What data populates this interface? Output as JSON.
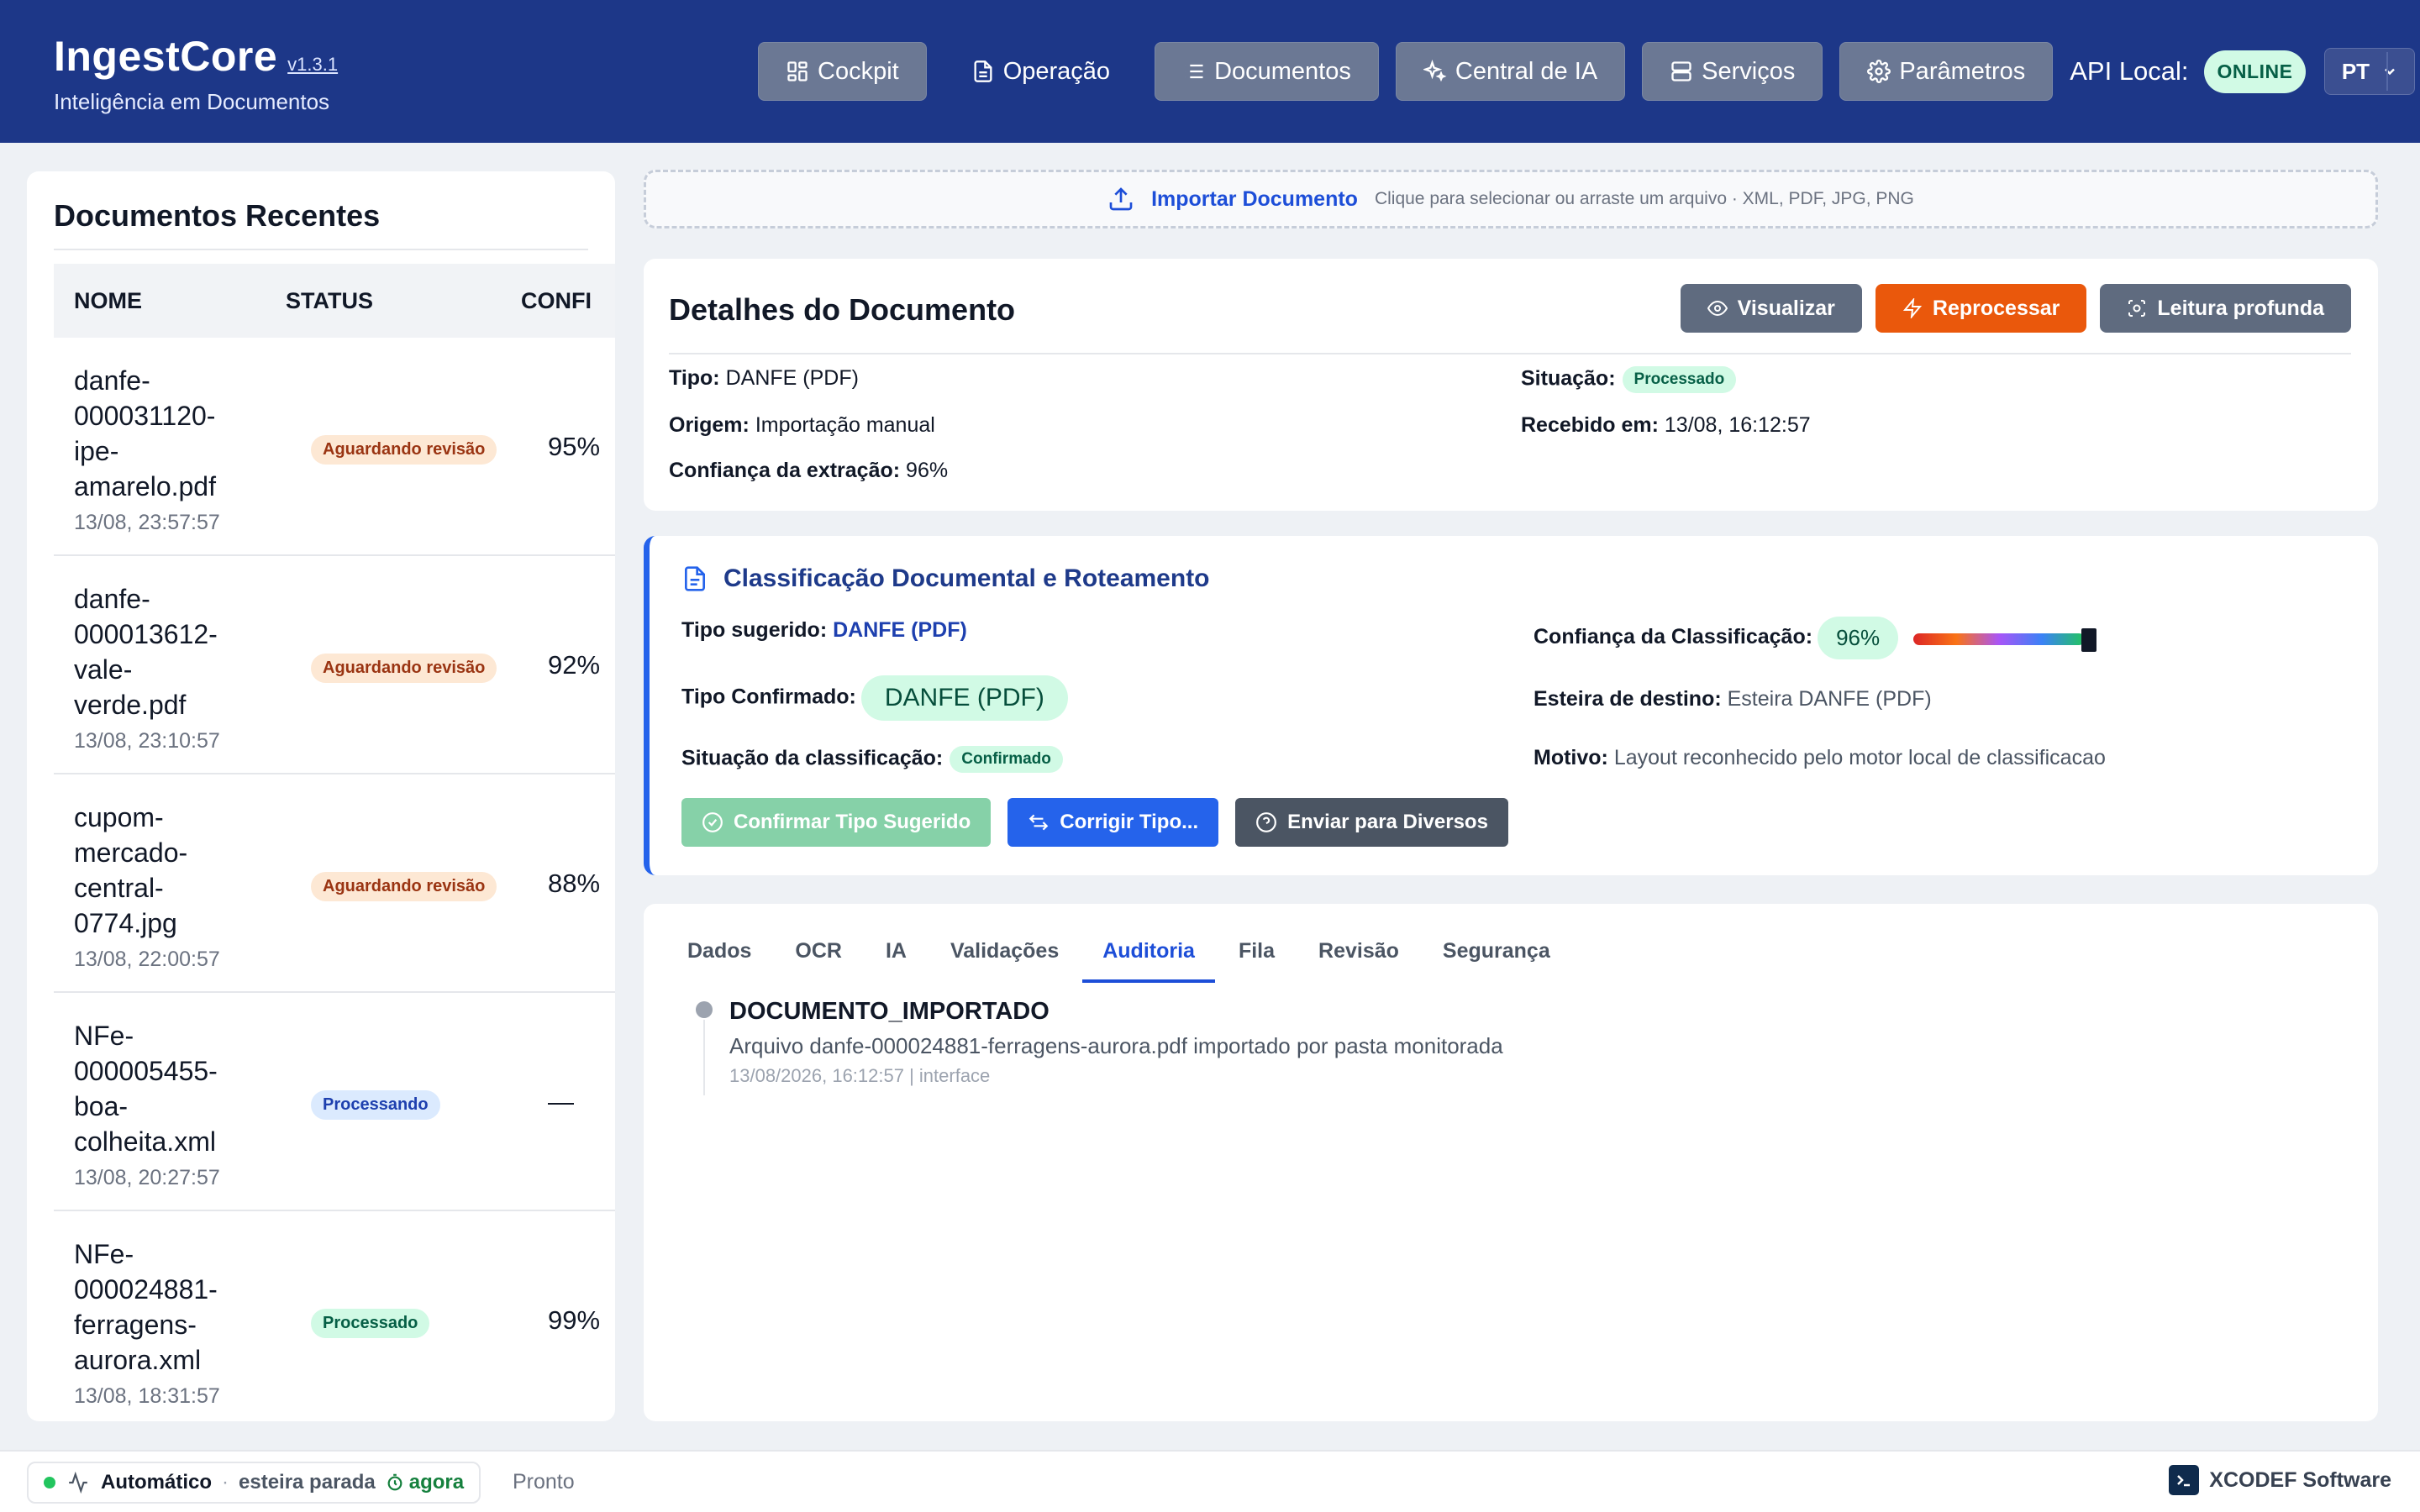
{
  "app": {
    "name": "IngestCore",
    "version": "v1.3.1",
    "subtitle": "Inteligência em Documentos"
  },
  "nav": {
    "items": [
      {
        "label": "Cockpit",
        "icon": "dashboard-icon"
      },
      {
        "label": "Operação",
        "icon": "document-icon"
      },
      {
        "label": "Documentos",
        "icon": "list-icon"
      },
      {
        "label": "Central de IA",
        "icon": "sparkles-icon"
      },
      {
        "label": "Serviços",
        "icon": "server-icon"
      },
      {
        "label": "Parâmetros",
        "icon": "gear-icon"
      }
    ],
    "api_label": "API Local:",
    "api_status": "ONLINE",
    "language": "PT"
  },
  "sidebar": {
    "title": "Documentos Recentes",
    "columns": [
      "NOME",
      "STATUS",
      "CONFI"
    ],
    "rows": [
      {
        "name_lines": [
          "danfe-",
          "000031120-",
          "ipe-",
          "amarelo.pdf"
        ],
        "time": "13/08, 23:57:57",
        "status": "Aguardando revisão",
        "confidence": "95%"
      },
      {
        "name_lines": [
          "danfe-",
          "000013612-",
          "vale-",
          "verde.pdf"
        ],
        "time": "13/08, 23:10:57",
        "status": "Aguardando revisão",
        "confidence": "92%"
      },
      {
        "name_lines": [
          "cupom-",
          "mercado-",
          "central-",
          "0774.jpg"
        ],
        "time": "13/08, 22:00:57",
        "status": "Aguardando revisão",
        "confidence": "88%"
      },
      {
        "name_lines": [
          "NFe-",
          "000005455-",
          "boa-",
          "colheita.xml"
        ],
        "time": "13/08, 20:27:57",
        "status": "Processando",
        "confidence": "—"
      },
      {
        "name_lines": [
          "NFe-",
          "000024881-",
          "ferragens-",
          "aurora.xml"
        ],
        "time": "13/08, 18:31:57",
        "status": "Processado",
        "confidence": "99%"
      }
    ]
  },
  "import": {
    "label": "Importar Documento",
    "hint": "Clique para selecionar ou arraste um arquivo · XML, PDF, JPG, PNG"
  },
  "details": {
    "title": "Detalhes do Documento",
    "actions": {
      "view": "Visualizar",
      "reprocess": "Reprocessar",
      "deep_read": "Leitura profunda"
    },
    "type_label": "Tipo:",
    "type_value": "DANFE (PDF)",
    "origin_label": "Origem:",
    "origin_value": "Importação manual",
    "confidence_label": "Confiança da extração:",
    "confidence_value": "96%",
    "status_label": "Situação:",
    "status_value": "Processado",
    "received_label": "Recebido em:",
    "received_value": "13/08, 16:12:57"
  },
  "classification": {
    "title": "Classificação Documental e Roteamento",
    "suggested_label": "Tipo sugerido:",
    "suggested_value": "DANFE (PDF)",
    "confirmed_label": "Tipo Confirmado:",
    "confirmed_value": "DANFE (PDF)",
    "state_label": "Situação da classificação:",
    "state_value": "Confirmado",
    "confidence_label": "Confiança da Classificação:",
    "confidence_value": "96%",
    "confidence_fraction": 0.96,
    "belt_label": "Esteira de destino:",
    "belt_value": "Esteira DANFE (PDF)",
    "reason_label": "Motivo:",
    "reason_value": "Layout reconhecido pelo motor local de classificacao",
    "actions": {
      "confirm": "Confirmar Tipo Sugerido",
      "correct": "Corrigir Tipo...",
      "send": "Enviar para Diversos"
    }
  },
  "tabs": {
    "items": [
      "Dados",
      "OCR",
      "IA",
      "Validações",
      "Auditoria",
      "Fila",
      "Revisão",
      "Segurança"
    ],
    "active": "Auditoria"
  },
  "audit": {
    "event": "DOCUMENTO_IMPORTADO",
    "description": "Arquivo danfe-000024881-ferragens-aurora.pdf importado por pasta monitorada",
    "meta": "13/08/2026, 16:12:57 | interface"
  },
  "footer": {
    "mode": "Automático",
    "separator": "·",
    "belt": "esteira parada",
    "since": "agora",
    "ready": "Pronto",
    "vendor": "XCODEF Software"
  },
  "colors": {
    "header": "#1d3788",
    "accent": "#2563eb",
    "orange": "#ea580c",
    "success": "#22c55e"
  }
}
